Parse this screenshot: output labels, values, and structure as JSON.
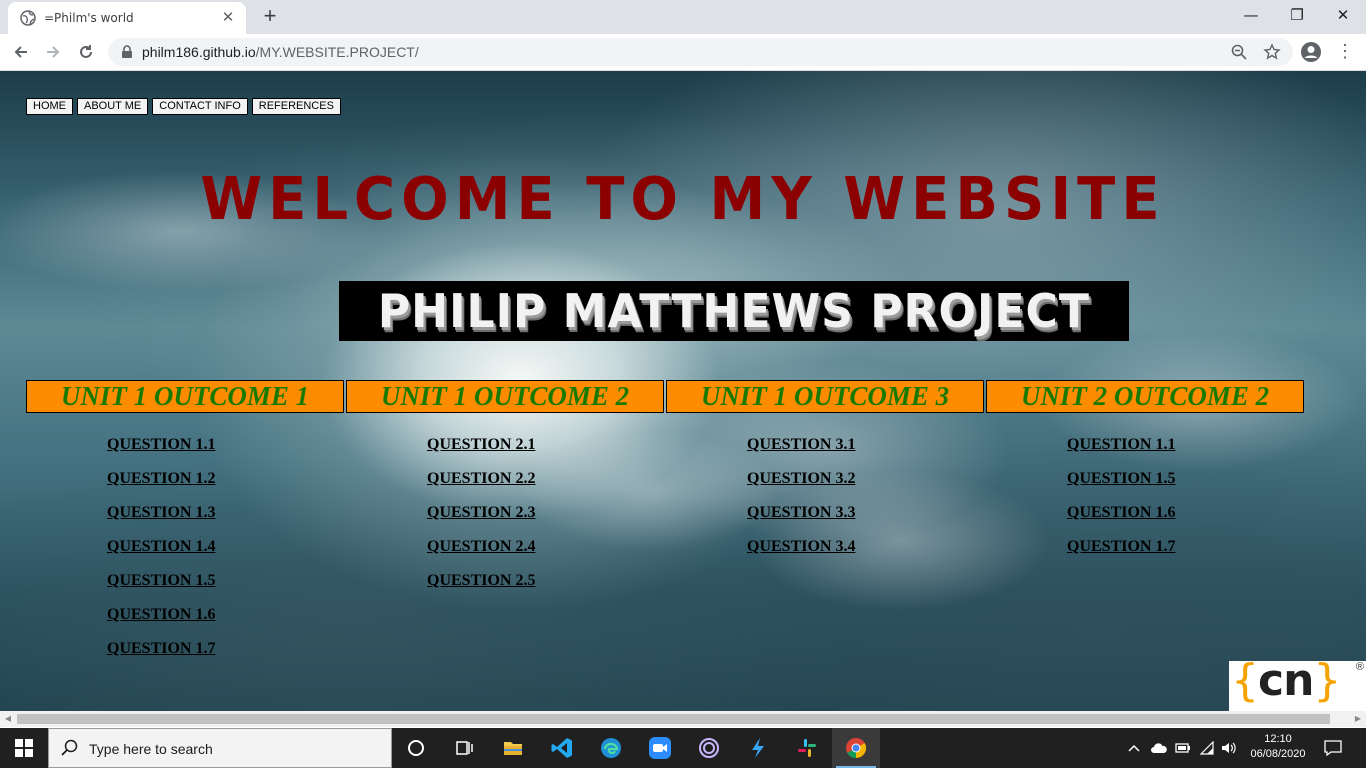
{
  "browser": {
    "tab_title": "=Philm's world",
    "url_host": "philm186.github.io",
    "url_path": "/MY.WEBSITE.PROJECT/"
  },
  "page": {
    "nav": [
      "HOME",
      "ABOUT ME",
      "CONTACT INFO",
      "REFERENCES"
    ],
    "welcome": "WELCOME TO MY WEBSITE",
    "project_title": "PHILIP MATTHEWS PROJECT",
    "columns": [
      {
        "heading": "UNIT 1 OUTCOME 1",
        "links": [
          "QUESTION 1.1",
          "QUESTION 1.2",
          "QUESTION 1.3",
          "QUESTION 1.4",
          "QUESTION 1.5",
          "QUESTION 1.6",
          "QUESTION 1.7"
        ]
      },
      {
        "heading": "UNIT 1 OUTCOME 2",
        "links": [
          "QUESTION 2.1",
          "QUESTION 2.2",
          "QUESTION 2.3",
          "QUESTION 2.4",
          "QUESTION 2.5"
        ]
      },
      {
        "heading": "UNIT 1 OUTCOME 3",
        "links": [
          "QUESTION 3.1",
          "QUESTION 3.2",
          "QUESTION 3.3",
          "QUESTION 3.4"
        ]
      },
      {
        "heading": "UNIT 2 OUTCOME 2",
        "links": [
          "QUESTION 1.1",
          "QUESTION 1.5",
          "QUESTION 1.6",
          "QUESTION 1.7"
        ]
      }
    ],
    "corner_logo_text": "{cn}",
    "corner_logo_mark": "®"
  },
  "taskbar": {
    "search_placeholder": "Type here to search",
    "time": "12:10",
    "date": "06/08/2020"
  },
  "colors": {
    "welcome": "#8b0000",
    "outcome_bg": "#ff8c00",
    "outcome_text": "#1a7a00"
  }
}
